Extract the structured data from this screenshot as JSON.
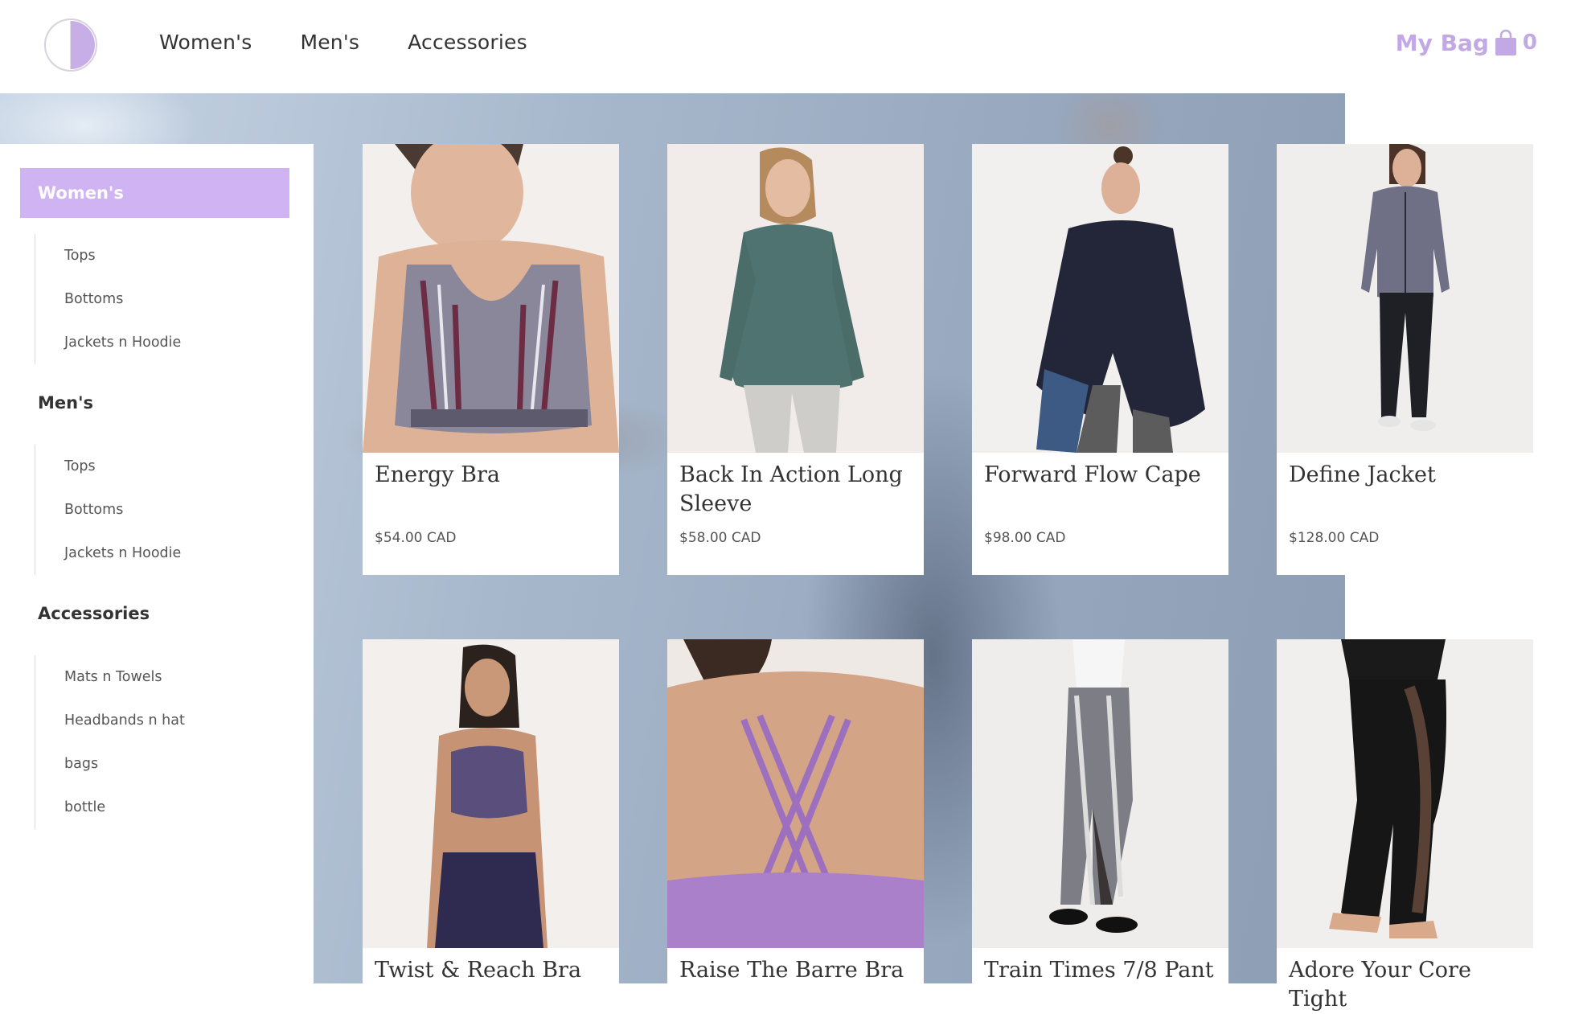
{
  "header": {
    "nav": [
      "Women's",
      "Men's",
      "Accessories"
    ],
    "bag_label": "My Bag",
    "bag_count": "0",
    "accent_color": "#c3a8e6"
  },
  "sidebar": {
    "active_label": "Women's",
    "women_items": [
      "Tops",
      "Bottoms",
      "Jackets n Hoodie"
    ],
    "mens_heading": "Men's",
    "mens_items": [
      "Tops",
      "Bottoms",
      "Jackets n Hoodie"
    ],
    "accessories_heading": "Accessories",
    "accessories_items": [
      "Mats n Towels",
      "Headbands n hat",
      "bags",
      "bottle"
    ]
  },
  "products": [
    {
      "name": "Energy Bra",
      "price": "$54.00 CAD"
    },
    {
      "name": "Back In Action Long Sleeve",
      "price": "$58.00 CAD"
    },
    {
      "name": "Forward Flow Cape",
      "price": "$98.00 CAD"
    },
    {
      "name": "Define Jacket",
      "price": "$128.00 CAD"
    },
    {
      "name": "Twist & Reach Bra",
      "price": ""
    },
    {
      "name": "Raise The Barre Bra",
      "price": ""
    },
    {
      "name": "Train Times 7/8 Pant",
      "price": ""
    },
    {
      "name": "Adore Your Core Tight",
      "price": ""
    }
  ]
}
